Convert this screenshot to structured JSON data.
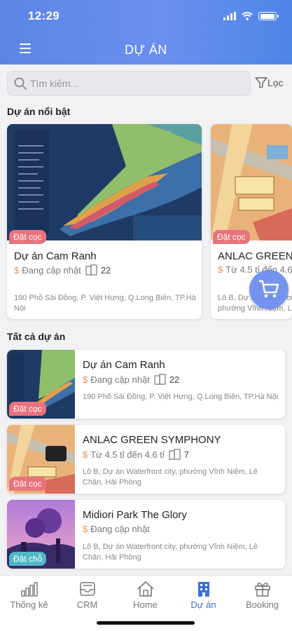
{
  "status": {
    "time": "12:29"
  },
  "header": {
    "title": "DỰ ÁN"
  },
  "search": {
    "placeholder": "Tìm kiếm..."
  },
  "filter": {
    "label": "Lọc"
  },
  "featured": {
    "title": "Dự án nổi bật",
    "items": [
      {
        "name": "Dự án Cam Ranh",
        "price": "Đang cập nhật",
        "count": "22",
        "badge": "Đặt cọc",
        "address": "190 Phố Sài Đồng, P. Việt Hưng, Q.Long Biên, TP.Hà Nội"
      },
      {
        "name": "ANLAC GREEN",
        "price": "Từ 4.5 tỉ đến 4.6",
        "count": "",
        "badge": "Đặt cọc",
        "address": "Lô B, Dự án Waterfront city, phường Vĩnh Niệm, Lê Chân"
      }
    ]
  },
  "all": {
    "title": "Tất cả dự án",
    "items": [
      {
        "name": "Dự án Cam Ranh",
        "price": "Đang cập nhật",
        "count": "22",
        "badge": "Đặt cọc",
        "address": "190 Phố Sài Đồng, P. Việt Hưng, Q.Long Biên, TP.Hà Nội"
      },
      {
        "name": "ANLAC GREEN SYMPHONY",
        "price": "Từ 4.5 tỉ đến 4.6 tỉ",
        "count": "7",
        "badge": "Đặt cọc",
        "address": "Lô B, Dự án Waterfront city, phường Vĩnh Niệm, Lê Chân, Hải Phòng"
      },
      {
        "name": "Midiori Park The Glory",
        "price": "Đang cập nhật",
        "count": "",
        "badge": "Đặt chỗ",
        "address": "Lô B, Dự án Waterfront city, phường Vĩnh Niệm, Lê Chân, Hải Phòng"
      }
    ]
  },
  "nav": {
    "items": [
      {
        "label": "Thống kê",
        "icon": "bar-chart-icon"
      },
      {
        "label": "CRM",
        "icon": "inbox-icon"
      },
      {
        "label": "Home",
        "icon": "home-icon"
      },
      {
        "label": "Dự án",
        "icon": "building-icon"
      },
      {
        "label": "Booking",
        "icon": "gift-icon"
      }
    ],
    "active": "Dự án"
  },
  "colors": {
    "accent": "#5b86e5",
    "badge_deposit": "#e8737b",
    "badge_reserve": "#4fb8c5",
    "price_symbol": "#e8925a",
    "active_nav": "#3a6fd8"
  }
}
